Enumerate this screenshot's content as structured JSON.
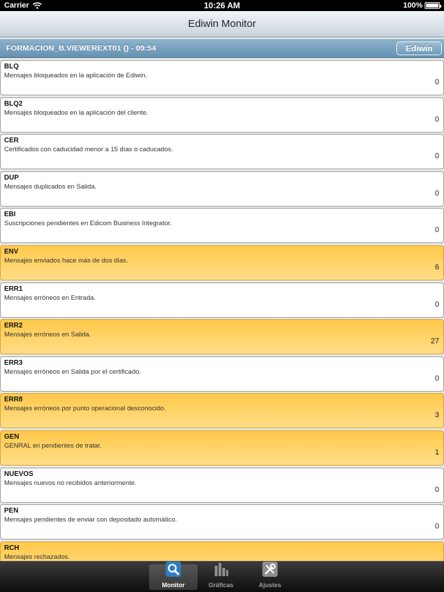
{
  "status": {
    "carrier": "Carrier",
    "time": "10:26 AM",
    "battery": "100%"
  },
  "nav": {
    "title": "Ediwin Monitor"
  },
  "header": {
    "title": "FORMACION_B.VIEWEREXT01 () - 09:54",
    "button": "Ediwin"
  },
  "rows": [
    {
      "code": "BLQ",
      "desc": "Mensajes bloqueados en la aplicación de Ediwin.",
      "count": "0",
      "alert": false
    },
    {
      "code": "BLQ2",
      "desc": "Mensajes bloqueados en la aplicación del cliente.",
      "count": "0",
      "alert": false
    },
    {
      "code": "CER",
      "desc": "Certificados con caducidad menor a 15 días o caducados.",
      "count": "0",
      "alert": false
    },
    {
      "code": "DUP",
      "desc": "Mensajes duplicados en Salida.",
      "count": "0",
      "alert": false
    },
    {
      "code": "EBI",
      "desc": "Suscripciones pendientes en Edicom Business Integrator.",
      "count": "0",
      "alert": false
    },
    {
      "code": "ENV",
      "desc": "Mensajes enviados hace más de dos días.",
      "count": "6",
      "alert": true
    },
    {
      "code": "ERR1",
      "desc": "Mensajes erróneos en Entrada.",
      "count": "0",
      "alert": false
    },
    {
      "code": "ERR2",
      "desc": "Mensajes erróneos en Salida.",
      "count": "27",
      "alert": true
    },
    {
      "code": "ERR3",
      "desc": "Mensajes erróneos en Salida por el certificado.",
      "count": "0",
      "alert": false
    },
    {
      "code": "ERR8",
      "desc": "Mensajes erróneos por punto operacional desconocido.",
      "count": "3",
      "alert": true
    },
    {
      "code": "GEN",
      "desc": "GENRAL en pendientes de tratar.",
      "count": "1",
      "alert": true
    },
    {
      "code": "NUEVOS",
      "desc": "Mensajes nuevos no recibidos anteriormente.",
      "count": "0",
      "alert": false
    },
    {
      "code": "PEN",
      "desc": "Mensajes pendientes de enviar con depositado automático.",
      "count": "0",
      "alert": false
    },
    {
      "code": "RCH",
      "desc": "Mensajes rechazados.",
      "count": "",
      "alert": true
    }
  ],
  "tabs": [
    {
      "label": "Monitor",
      "icon": "search-icon",
      "active": true
    },
    {
      "label": "Gráficas",
      "icon": "bar-chart-icon",
      "active": false
    },
    {
      "label": "Ajustes",
      "icon": "tools-icon",
      "active": false
    }
  ],
  "colors": {
    "alert_row": "#ffc94a",
    "header_bar": "#6592b1",
    "tab_bar": "#1a1a1a"
  }
}
